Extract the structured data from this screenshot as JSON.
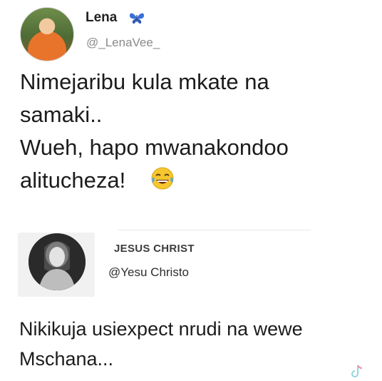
{
  "tweet1": {
    "display_name": "Lena",
    "handle": "@_LenaVee_",
    "text": "Nimejaribu kula mkate na\nsamaki..\nWueh, hapo mwanakondoo\nalitucheza!",
    "name_badge_icon": "butterfly-icon",
    "trailing_emoji": "laughing-crying-emoji"
  },
  "tweet2": {
    "display_name": "JESUS CHRIST",
    "handle": "@Yesu Christo",
    "text": "Nikikuja usiexpect nrudi na wewe\nMschana..."
  },
  "colors": {
    "text": "#1c1c1c",
    "handle_gray": "#8a8a8a",
    "butterfly_blue": "#3a6fd8"
  }
}
